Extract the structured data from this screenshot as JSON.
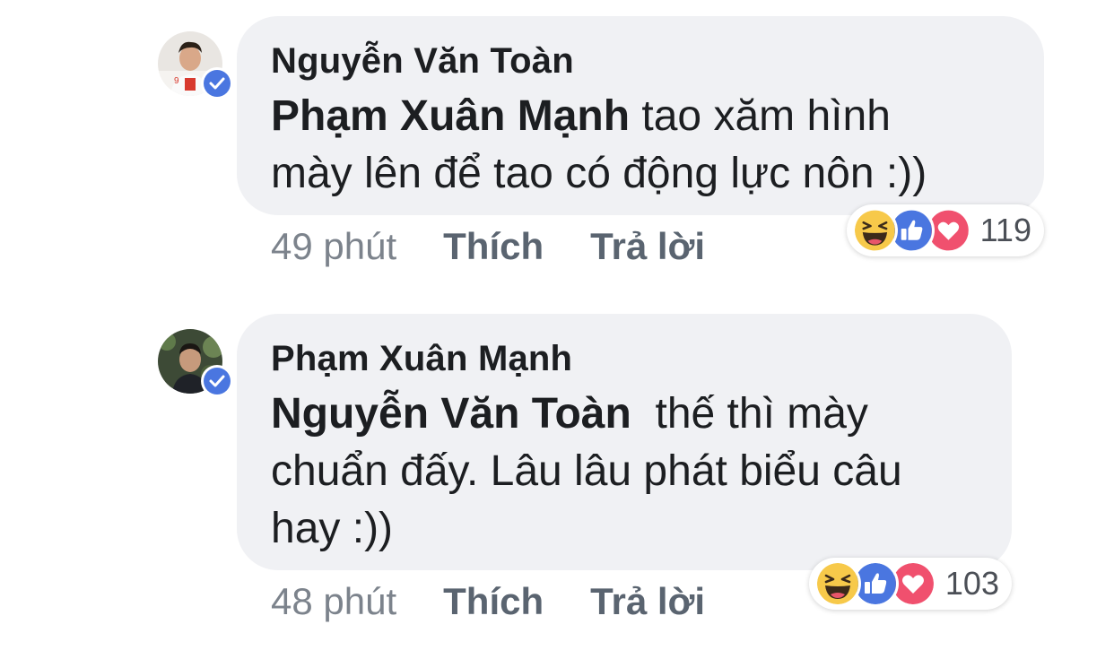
{
  "comments": [
    {
      "author": "Nguyễn Văn Toàn",
      "mention": "Phạm Xuân Mạnh",
      "text_line1": " tao xăm hình",
      "text_line2": "mày lên để tao có động lực nôn :))",
      "time": "49 phút",
      "like_label": "Thích",
      "reply_label": "Trả lời",
      "reaction_count": "119",
      "reactions": [
        "haha-icon",
        "like-icon",
        "love-icon"
      ]
    },
    {
      "author": "Phạm Xuân Mạnh",
      "mention": "Nguyễn Văn Toàn",
      "text_line1": "  thế thì mày",
      "text_line2": "chuẩn đấy. Lâu lâu phát biểu câu",
      "text_line3": "hay :))",
      "time": "48 phút",
      "like_label": "Thích",
      "reply_label": "Trả lời",
      "reaction_count": "103",
      "reactions": [
        "haha-icon",
        "like-icon",
        "love-icon"
      ]
    }
  ],
  "colors": {
    "bubble": "#f0f1f4",
    "verified": "#4a76e0",
    "like": "#4a76e0",
    "love": "#f0506e",
    "haha": "#f7c94a"
  }
}
